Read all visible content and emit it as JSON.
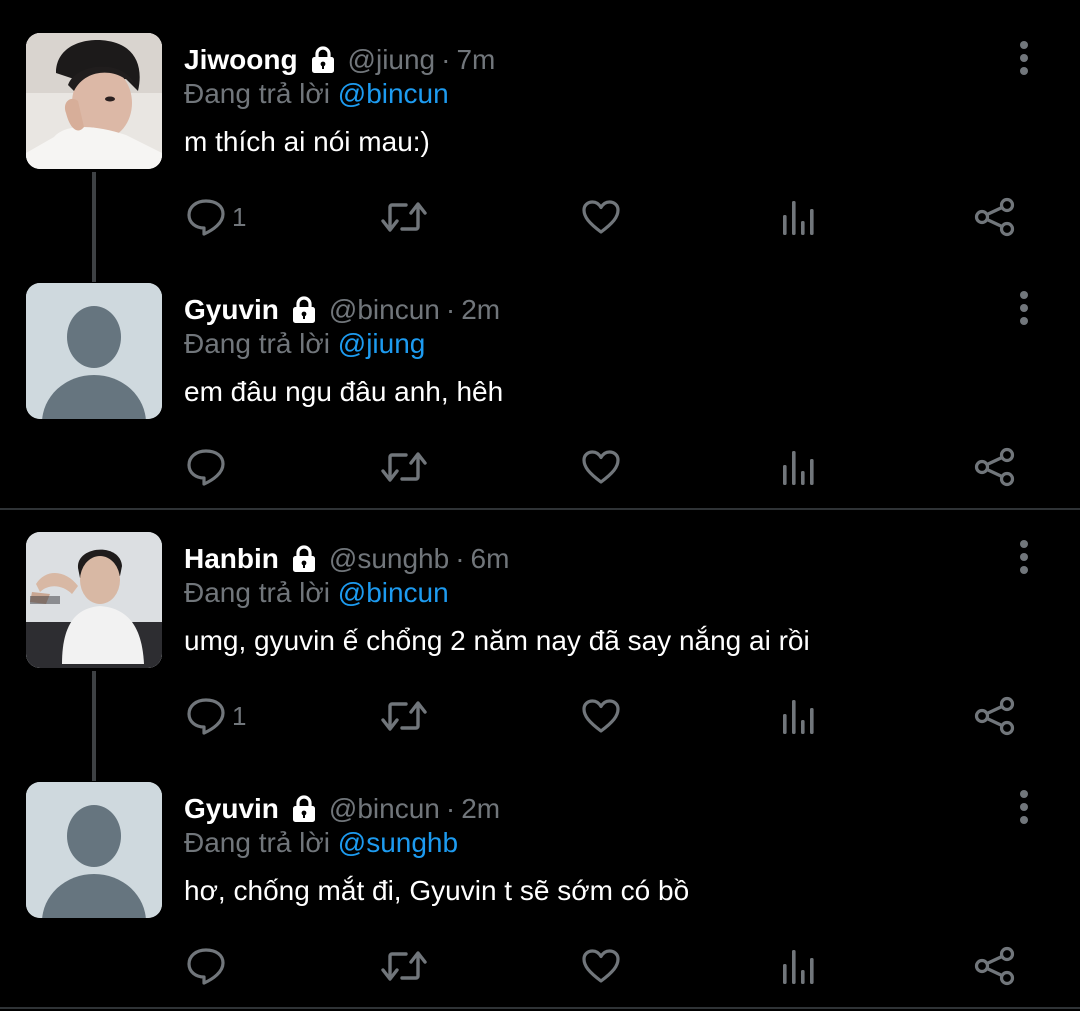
{
  "colors": {
    "background": "#000000",
    "name": "#ffffff",
    "secondary": "#71767b",
    "mention": "#1d9bf0",
    "divider": "#2f3336"
  },
  "tweets": [
    {
      "name": "Jiwoong",
      "handle": "@jiung",
      "separator": "·",
      "time": "7m",
      "reply_prefix": "Đang trả lời",
      "reply_to": "@bincun",
      "text": "m thích ai nói mau:)",
      "reply_count": "1",
      "avatar": "photo"
    },
    {
      "name": "Gyuvin",
      "handle": "@bincun",
      "separator": "·",
      "time": "2m",
      "reply_prefix": "Đang trả lời",
      "reply_to": "@jiung",
      "text": "em đâu ngu đâu anh, hêh",
      "reply_count": "",
      "avatar": "default-profile"
    },
    {
      "name": "Hanbin",
      "handle": "@sunghb",
      "separator": "·",
      "time": "6m",
      "reply_prefix": "Đang trả lời",
      "reply_to": "@bincun",
      "text": "umg, gyuvin ế chổng 2 năm nay đã say nắng ai rồi",
      "reply_count": "1",
      "avatar": "photo"
    },
    {
      "name": "Gyuvin",
      "handle": "@bincun",
      "separator": "·",
      "time": "2m",
      "reply_prefix": "Đang trả lời",
      "reply_to": "@sunghb",
      "text": "hơ, chống mắt đi, Gyuvin t sẽ sớm có bồ",
      "reply_count": "",
      "avatar": "default-profile"
    }
  ],
  "icons": {
    "protected": "lock-icon",
    "more": "more-vertical-icon",
    "reply": "reply-icon",
    "retweet": "retweet-icon",
    "like": "like-icon",
    "views": "views-icon",
    "share": "share-icon"
  }
}
